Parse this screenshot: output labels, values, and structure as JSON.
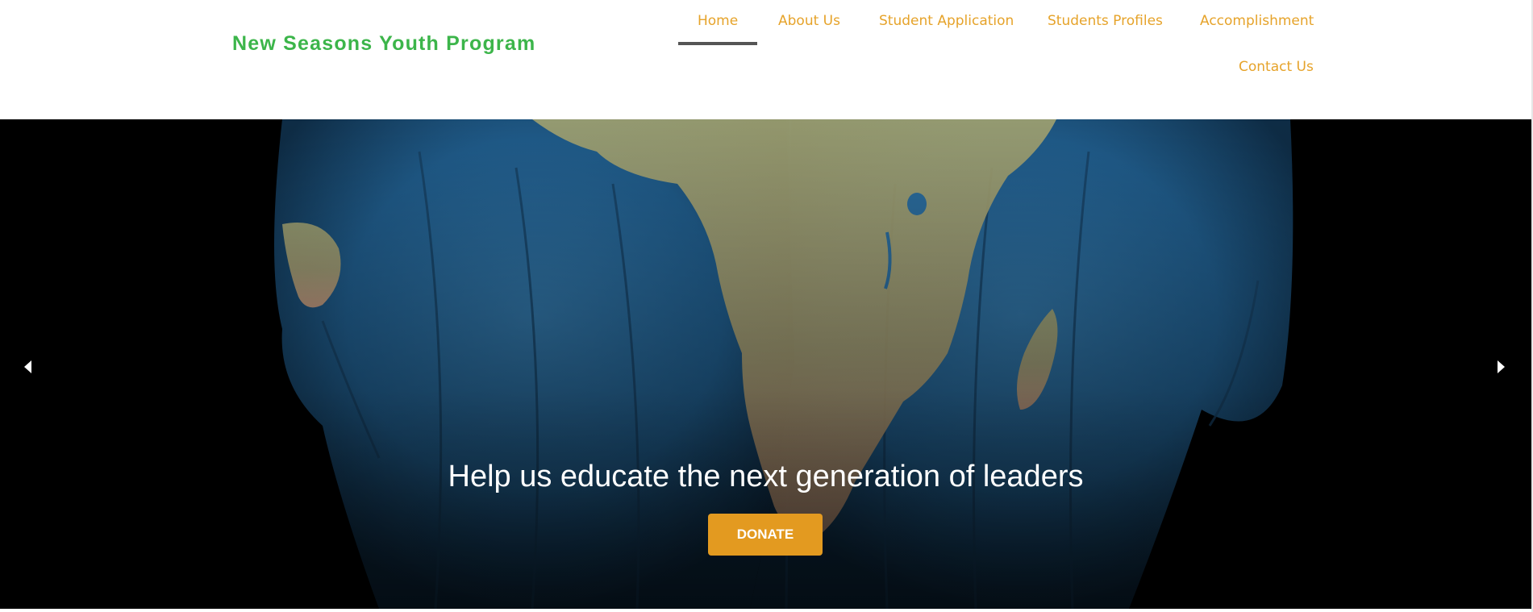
{
  "brand": {
    "name": "New Seasons Youth Program",
    "color": "#3cb54a"
  },
  "nav": {
    "accent_color": "#e6a32a",
    "items": [
      {
        "label": "Home",
        "active": true
      },
      {
        "label": "About Us"
      },
      {
        "label": "Student Application"
      },
      {
        "label": "Students Profiles"
      },
      {
        "label": "Accomplishment"
      },
      {
        "label": "Contact Us"
      }
    ]
  },
  "hero": {
    "headline": "Help us educate the next generation of leaders",
    "cta_label": "DONATE",
    "cta_color": "#e39a20",
    "prev_icon": "triangle-left-icon",
    "next_icon": "triangle-right-icon",
    "image": "hands-painted-with-world-map-africa"
  }
}
